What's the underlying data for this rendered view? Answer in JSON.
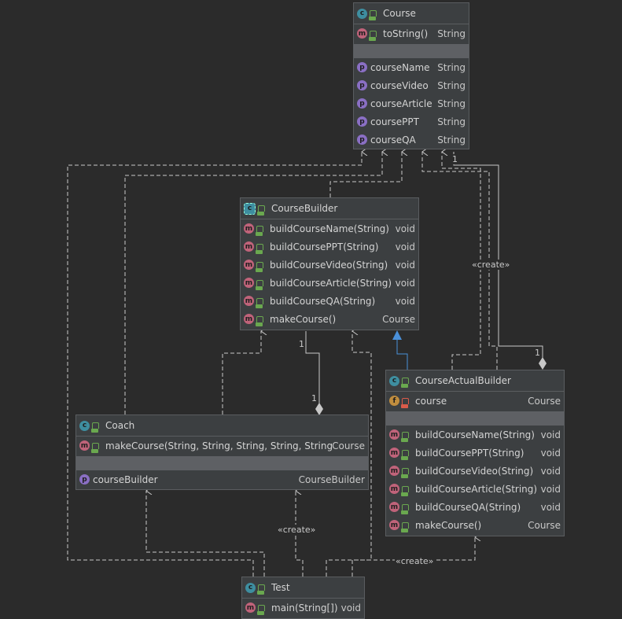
{
  "classes": {
    "course": {
      "name": "Course",
      "kind_icon": "class-icon",
      "methods": [
        {
          "name": "toString()",
          "type": "String"
        }
      ],
      "properties": [
        {
          "name": "courseName",
          "type": "String"
        },
        {
          "name": "courseVideo",
          "type": "String"
        },
        {
          "name": "courseArticle",
          "type": "String"
        },
        {
          "name": "coursePPT",
          "type": "String"
        },
        {
          "name": "courseQA",
          "type": "String"
        }
      ]
    },
    "course_builder": {
      "name": "CourseBuilder",
      "kind_icon": "abstract-class-icon",
      "methods": [
        {
          "name": "buildCourseName(String)",
          "type": "void"
        },
        {
          "name": "buildCoursePPT(String)",
          "type": "void"
        },
        {
          "name": "buildCourseVideo(String)",
          "type": "void"
        },
        {
          "name": "buildCourseArticle(String)",
          "type": "void"
        },
        {
          "name": "buildCourseQA(String)",
          "type": "void"
        },
        {
          "name": "makeCourse()",
          "type": "Course"
        }
      ]
    },
    "coach": {
      "name": "Coach",
      "kind_icon": "class-icon",
      "methods": [
        {
          "name": "makeCourse(String, String, String, String, String)",
          "type": "Course"
        }
      ],
      "properties": [
        {
          "name": "courseBuilder",
          "type": "CourseBuilder"
        }
      ]
    },
    "course_actual_builder": {
      "name": "CourseActualBuilder",
      "kind_icon": "class-icon",
      "fields": [
        {
          "name": "course",
          "type": "Course"
        }
      ],
      "methods": [
        {
          "name": "buildCourseName(String)",
          "type": "void"
        },
        {
          "name": "buildCoursePPT(String)",
          "type": "void"
        },
        {
          "name": "buildCourseVideo(String)",
          "type": "void"
        },
        {
          "name": "buildCourseArticle(String)",
          "type": "void"
        },
        {
          "name": "buildCourseQA(String)",
          "type": "void"
        },
        {
          "name": "makeCourse()",
          "type": "Course"
        }
      ]
    },
    "test": {
      "name": "Test",
      "kind_icon": "runnable-class-icon",
      "methods": [
        {
          "name": "main(String[])",
          "type": "void"
        }
      ]
    }
  },
  "edge_labels": {
    "create_1": "«create»",
    "create_2": "«create»",
    "create_3": "«create»",
    "mult_builder_a": "1",
    "mult_builder_b": "1",
    "mult_course_a": "1",
    "mult_course_b": "1"
  },
  "colors": {
    "background": "#2b2b2b",
    "box": "#3c3f41",
    "separator": "#5e6064",
    "edge": "#c8c8c8",
    "inheritance": "#4a90d9",
    "class_badge": "#3e8ea0",
    "method_badge": "#c0637a",
    "property_badge": "#8a6fc4",
    "field_badge": "#c08d3e"
  }
}
